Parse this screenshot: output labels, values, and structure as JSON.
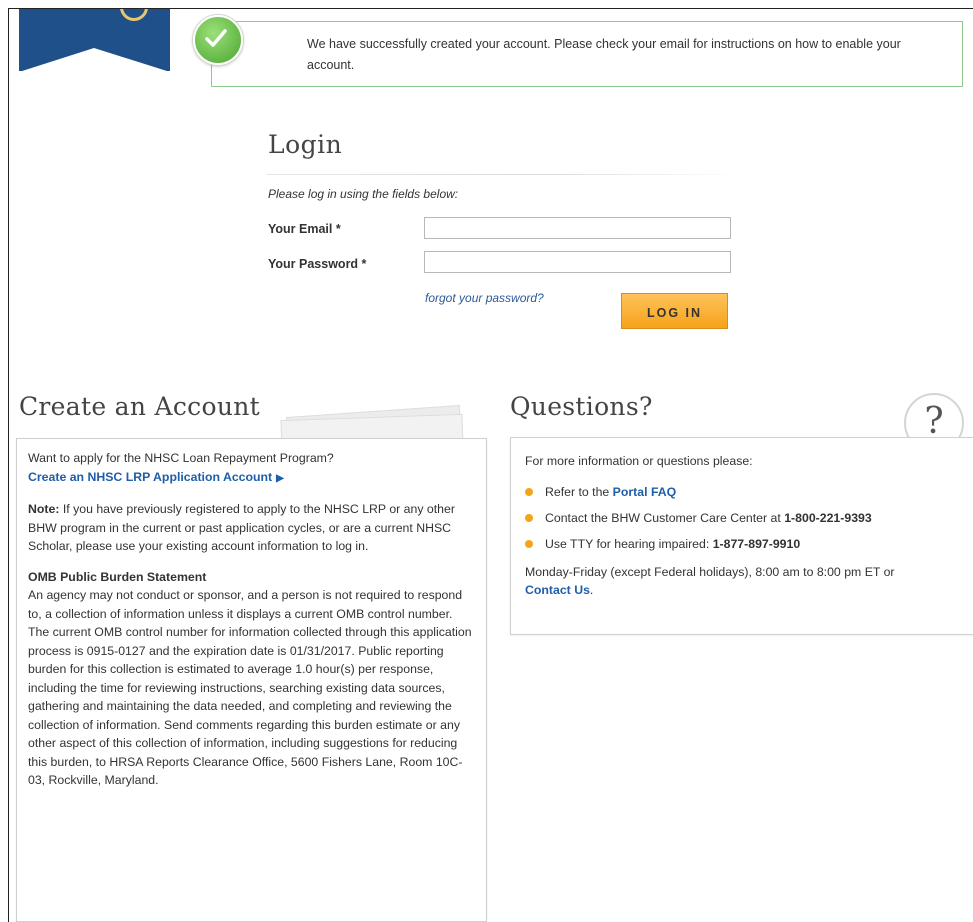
{
  "success": {
    "message": "We have successfully created your account. Please check your email for instructions on how to enable your account."
  },
  "login": {
    "title": "Login",
    "instructions": "Please log in using the fields below:",
    "email_label": "Your Email *",
    "email_value": "",
    "password_label": "Your Password *",
    "password_value": "",
    "forgot_link": "forgot your password?",
    "login_button": "LOG IN"
  },
  "create_account": {
    "title": "Create an Account",
    "intro": "Want to apply for the NHSC Loan Repayment Program?",
    "create_link": "Create an NHSC LRP Application Account",
    "note_label": "Note:",
    "note_text": " If you have previously registered to apply to the NHSC LRP or any other BHW program in the current or past application cycles, or are a current NHSC Scholar, please use your existing account information to log in.",
    "omb_heading": "OMB Public Burden Statement",
    "omb_text": "An agency may not conduct or sponsor, and a person is not required to respond to, a collection of information unless it displays a current OMB control number. The current OMB control number for information collected through this application process is 0915-0127 and the expiration date is 01/31/2017. Public reporting burden for this collection is estimated to average 1.0 hour(s) per response, including the time for reviewing instructions, searching existing data sources, gathering and maintaining the data needed, and completing and reviewing the collection of information. Send comments regarding this burden estimate or any other aspect of this collection of information, including suggestions for reducing this burden, to HRSA Reports Clearance Office, 5600 Fishers Lane, Room 10C-03, Rockville, Maryland."
  },
  "questions": {
    "title": "Questions?",
    "icon_glyph": "?",
    "intro": "For more information or questions please:",
    "items": [
      {
        "prefix": "Refer to the ",
        "link": "Portal FAQ"
      },
      {
        "prefix": "Contact the BHW Customer Care Center at ",
        "bold": "1-800-221-9393"
      },
      {
        "prefix": "Use TTY for hearing impaired: ",
        "bold": "1-877-897-9910"
      }
    ],
    "hours": "Monday-Friday (except Federal holidays), 8:00 am to 8:00 pm ET or",
    "contact_link": "Contact Us",
    "contact_suffix": "."
  },
  "colors": {
    "banner_blue": "#1f5089",
    "success_border": "#8fc98c",
    "button_orange": "#f5a31a",
    "link_blue": "#1f5ea8"
  }
}
